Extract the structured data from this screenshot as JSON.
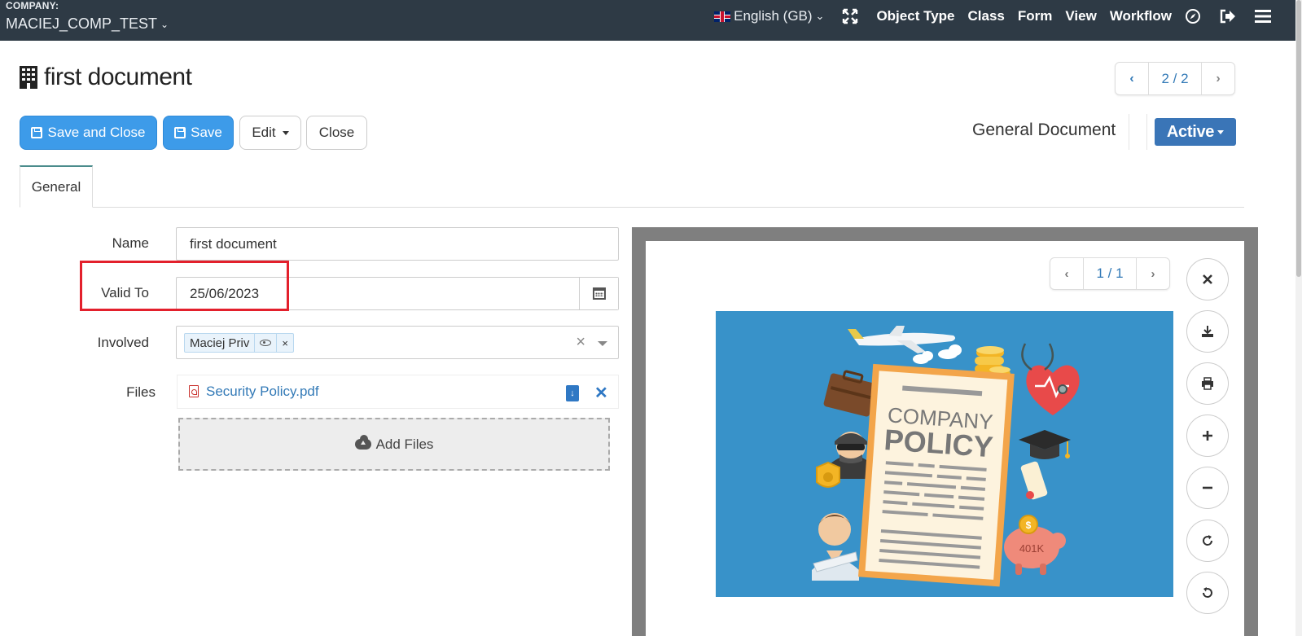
{
  "header": {
    "company_label": "COMPANY:",
    "company_name": "MACIEJ_COMP_TEST",
    "language": "English (GB)",
    "nav": [
      "Object Type",
      "Class",
      "Form",
      "View",
      "Workflow"
    ],
    "icons": [
      "fullscreen-icon",
      "compass-icon",
      "sign-out-icon",
      "menu-icon"
    ]
  },
  "page": {
    "title": "first document",
    "pager": "2 / 2"
  },
  "toolbar": {
    "save_close_label": "Save and Close",
    "save_label": "Save",
    "edit_label": "Edit",
    "close_label": "Close",
    "document_type": "General Document",
    "status_label": "Active"
  },
  "tabs": [
    {
      "label": "General",
      "active": true
    }
  ],
  "form": {
    "name_label": "Name",
    "name_value": "first document",
    "valid_to_label": "Valid To",
    "valid_to_value": "25/06/2023",
    "involved_label": "Involved",
    "involved_tag": "Maciej Priv",
    "involved_tag_remove": "×",
    "involved_clear": "×",
    "files_label": "Files",
    "file_name": "Security Policy.pdf",
    "add_files_label": "Add Files"
  },
  "viewer": {
    "pager": "1 / 1",
    "tools": [
      "close-icon",
      "download-icon",
      "print-icon",
      "zoom-in-icon",
      "zoom-out-icon",
      "rotate-right-icon",
      "rotate-left-icon"
    ],
    "preview": {
      "heading_line1": "COMPANY",
      "heading_line2": "POLICY",
      "badge": "401K"
    }
  },
  "colors": {
    "navbar": "#2e3a45",
    "primary_button": "#3d9be9",
    "status_button": "#3a75b7",
    "highlight": "#e3202c",
    "preview_background": "#3892c9"
  }
}
